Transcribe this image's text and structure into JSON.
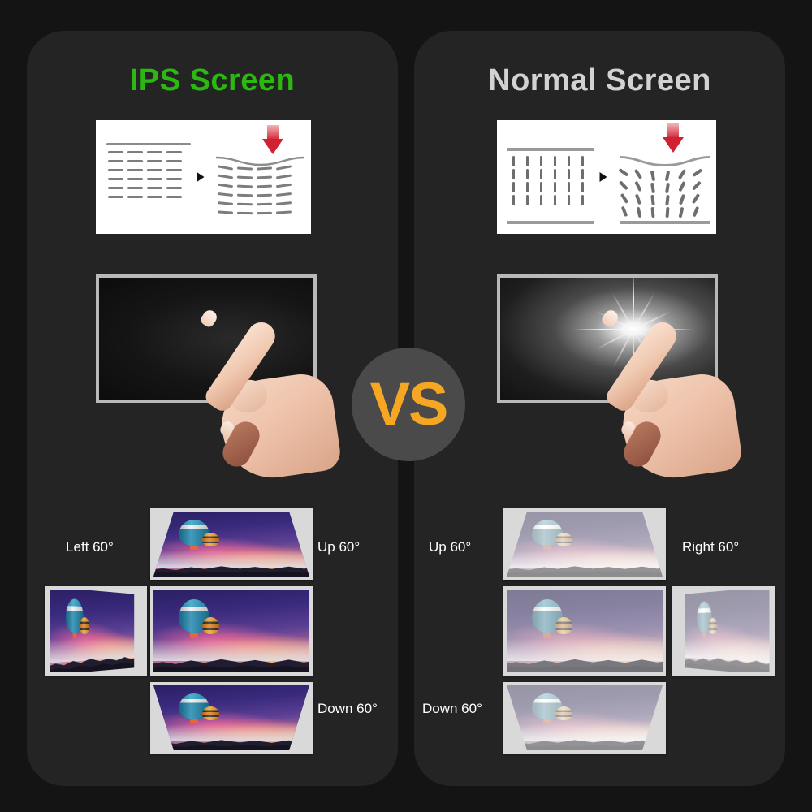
{
  "background": {
    "page": "#141414",
    "panel": "#242424"
  },
  "colors": {
    "ips_title": "#2bb911",
    "normal_title": "#d2d2d2",
    "vs_text": "#f5a623",
    "vs_circle": "#4a4a4a",
    "label_text": "#ffffff",
    "frame": "#d9d9d9",
    "pressure_arrow": "#cf2130"
  },
  "panels": {
    "left": {
      "title": "IPS Screen",
      "pressure_diagram": {
        "name": "ips-pressure-test",
        "before_state": "horizontal aligned liquid crystal layers",
        "after_state": "layers bend smoothly under pressure, no distortion",
        "arrow_icon": "pressure-down-arrow-icon",
        "transition_icon": "play-triangle-icon"
      },
      "touch_demo": {
        "name": "ips-touch-demo",
        "screen_state": "uniform dark, no light bloom under finger pressure",
        "hand_icon": "pointing-finger-icon"
      },
      "viewing_angles": {
        "left": "Left 60°",
        "up": "Up 60°",
        "down": "Down 60°",
        "image_quality": "vivid, full color and contrast at every angle"
      }
    },
    "right": {
      "title": "Normal Screen",
      "pressure_diagram": {
        "name": "normal-pressure-test",
        "before_state": "vertical liquid crystal columns",
        "after_state": "columns scatter and splay under pressure, causing distortion",
        "arrow_icon": "pressure-down-arrow-icon",
        "transition_icon": "play-triangle-icon"
      },
      "touch_demo": {
        "name": "normal-touch-demo",
        "screen_state": "bright white starburst bloom under finger pressure",
        "hand_icon": "pointing-finger-icon"
      },
      "viewing_angles": {
        "up": "Up 60°",
        "right": "Right 60°",
        "down": "Down 60°",
        "image_quality": "washed out, faded color and contrast off-axis"
      }
    }
  },
  "center": {
    "vs_label": "VS",
    "badge_name": "versus-badge"
  },
  "artwork": {
    "subject": "hot air balloons at sunset over mountains",
    "palette": {
      "sky_top": "#2a1f63",
      "sky_mid": "#5b3f93",
      "sunset": "#f9b98a",
      "clouds": "#f5748f",
      "balloon_main": "#2a9ec4",
      "balloon_accent": "#e8643a",
      "balloon_small": "#f0a42c",
      "mountains": "#201d30"
    }
  }
}
